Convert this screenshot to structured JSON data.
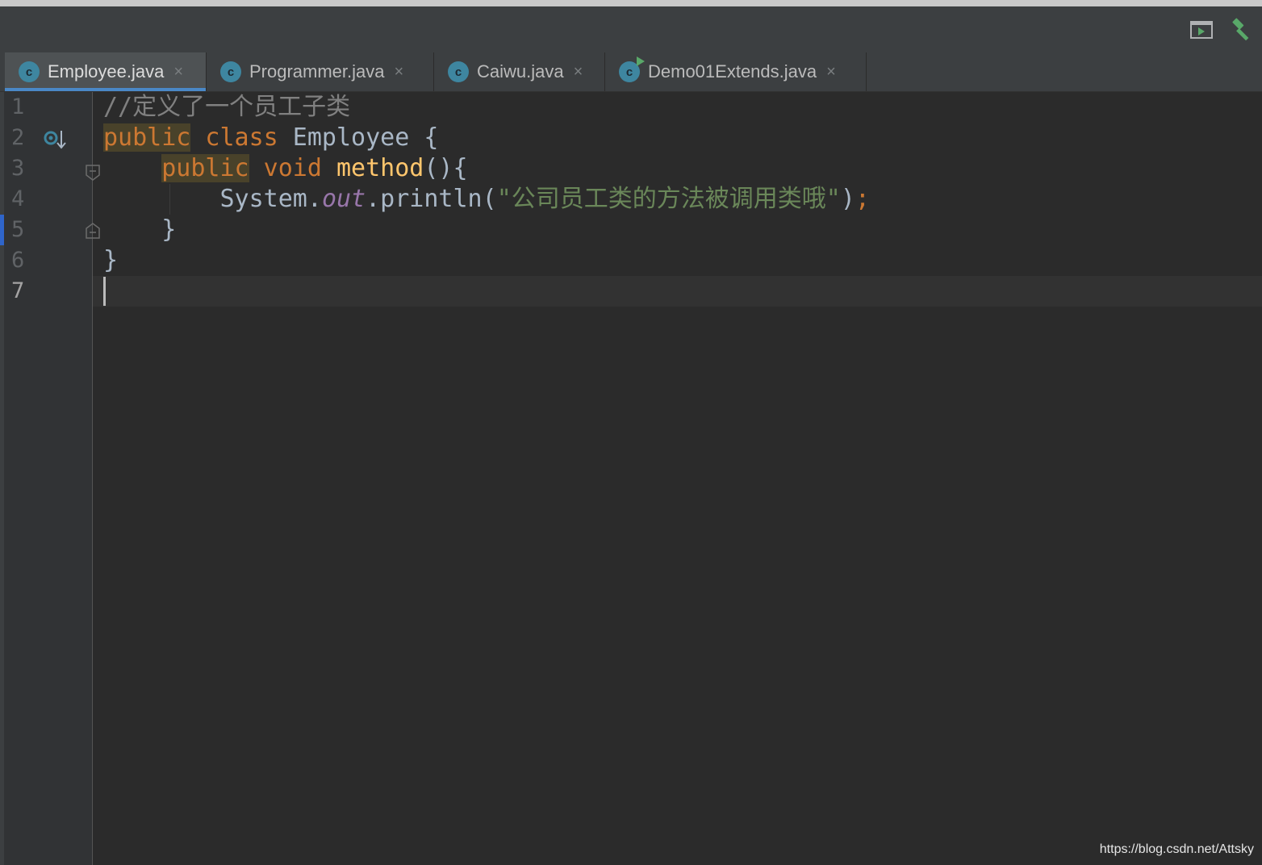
{
  "tabs": [
    {
      "label": "Employee.java",
      "icon": "java-class-icon",
      "active": true
    },
    {
      "label": "Programmer.java",
      "icon": "java-class-icon",
      "active": false
    },
    {
      "label": "Caiwu.java",
      "icon": "java-class-icon",
      "active": false
    },
    {
      "label": "Demo01Extends.java",
      "icon": "java-runnable-class-icon",
      "active": false
    }
  ],
  "tab_close_glyph": "×",
  "class_icon_glyph": "c",
  "editor": {
    "line_numbers": [
      "1",
      "2",
      "3",
      "4",
      "5",
      "6",
      "7"
    ],
    "current_line": "7",
    "code": {
      "l1_comment": "//定义了一个员工子类",
      "l2_public": "public",
      "l2_class": " class",
      "l2_rest": " Employee {",
      "l3_public": "public",
      "l3_void": " void",
      "l3_method": " method",
      "l3_rest": "(){",
      "l4_system": "System.",
      "l4_out": "out",
      "l4_println": ".println(",
      "l4_string": "\"公司员工类的方法被调用类哦\"",
      "l4_close": ")",
      "l4_semi": ";",
      "l5_brace": "}",
      "l6_brace": "}"
    }
  },
  "watermark": "https://blog.csdn.net/Attsky",
  "colors": {
    "background": "#2b2b2b",
    "keyword": "#cc7832",
    "string": "#6a8759",
    "comment": "#808080",
    "field": "#9876aa",
    "method_declaration": "#ffc66d",
    "accent": "#4a88c7",
    "build_hammer": "#59a869"
  }
}
